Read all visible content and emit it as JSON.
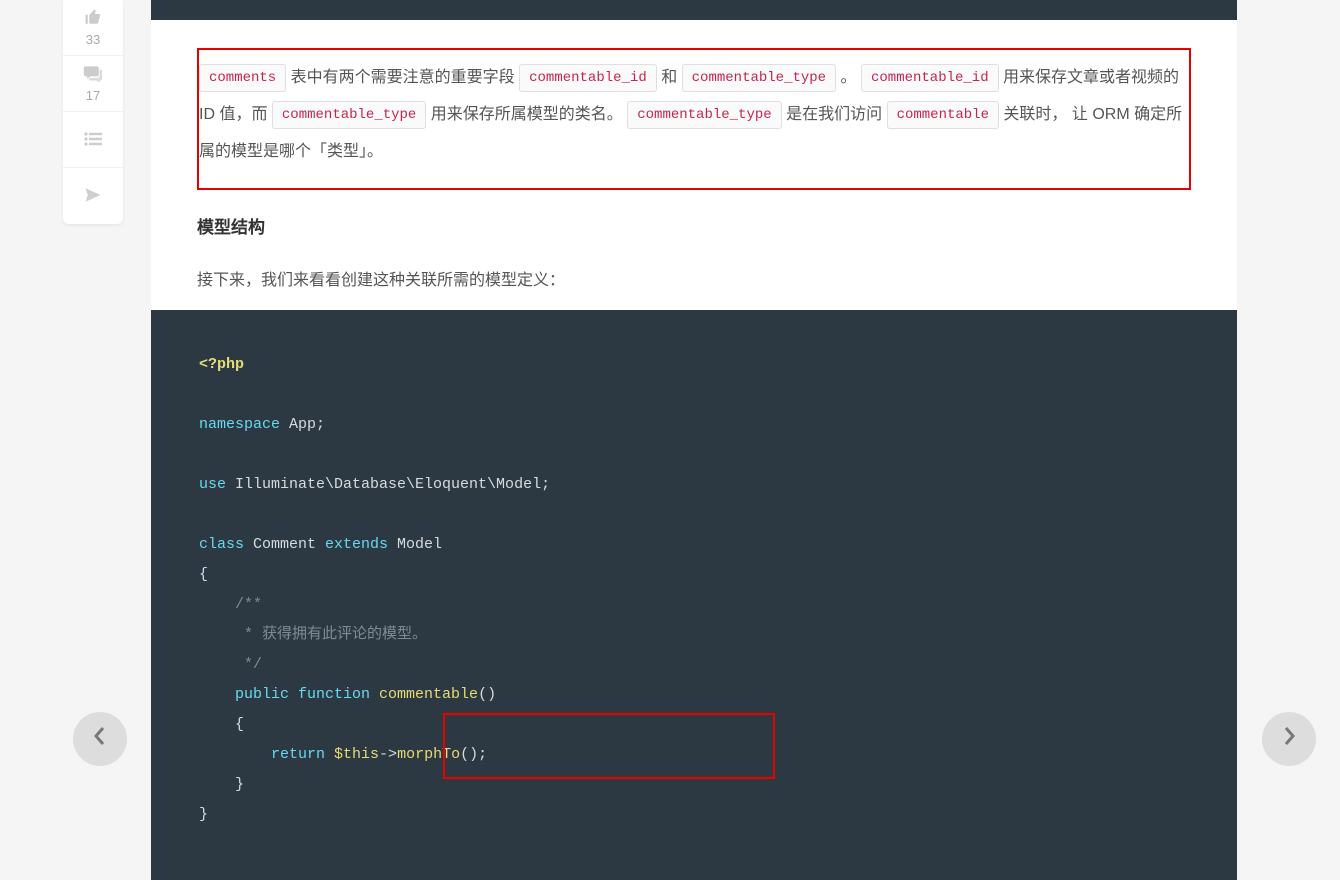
{
  "sidebar": {
    "like_count": "33",
    "comment_count": "17"
  },
  "article": {
    "p1_parts": {
      "tok1": "comments",
      "t1": " 表中有两个需要注意的重要字段 ",
      "tok2": "commentable_id",
      "t2": " 和 ",
      "tok3": "commentable_type",
      "t3": " 。 ",
      "tok4": "commentable_id",
      "t4": " 用来保存文章或者视频的 ID 值，而 ",
      "tok5": "commentable_type",
      "t5": " 用来保存所属模型的类名。 ",
      "tok6": "commentable_type",
      "t6": " 是在我们访问 ",
      "tok7": "commentable",
      "t7": " 关联时， 让 ORM 确定所属的模型是哪个「类型」。"
    },
    "heading": "模型结构",
    "p2": "接下来，我们来看看创建这种关联所需的模型定义：",
    "code": {
      "l1": "<?php",
      "l2a": "namespace",
      "l2b": " App;",
      "l3a": "use",
      "l3b": " Illuminate\\Database\\Eloquent\\Model;",
      "l4a": "class",
      "l4b": " Comment ",
      "l4c": "extends",
      "l4d": " Model",
      "l5": "{",
      "l6": "    /**",
      "l7": "     * 获得拥有此评论的模型。",
      "l8": "     */",
      "l9a": "    public",
      "l9b": " function",
      "l9c": " commentable",
      "l9d": "()",
      "l10": "    {",
      "l11a": "        return",
      "l11b": " $this",
      "l11c": "->",
      "l11d": "morphTo",
      "l11e": "();",
      "l12": "    }",
      "l13": "}"
    }
  }
}
